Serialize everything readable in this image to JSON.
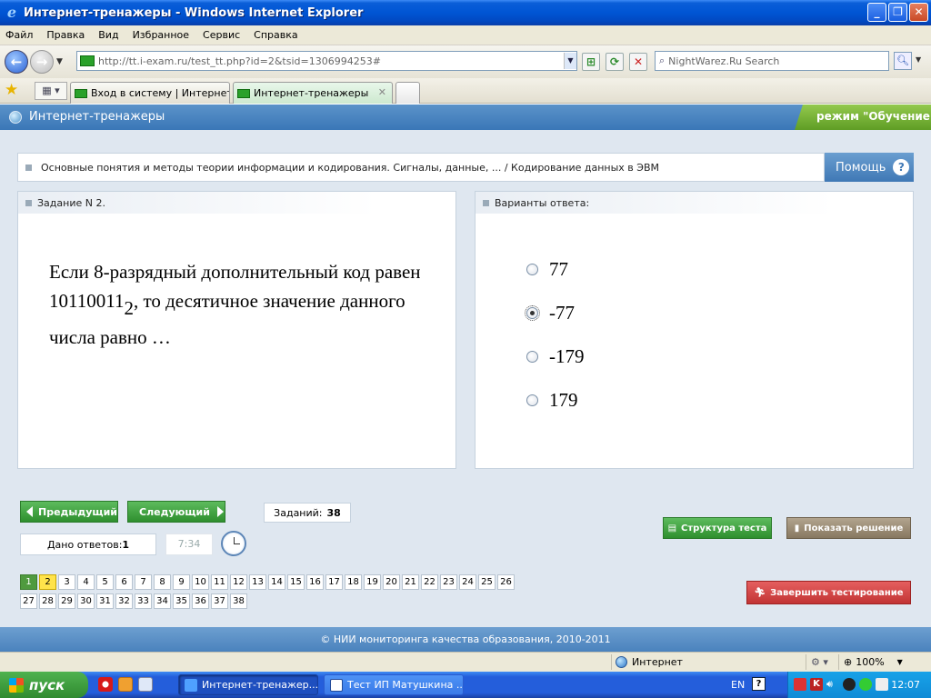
{
  "window": {
    "title": "Интернет-тренажеры - Windows Internet Explorer",
    "min": "_",
    "max": "❐",
    "close": "✕"
  },
  "menu": [
    "Файл",
    "Правка",
    "Вид",
    "Избранное",
    "Сервис",
    "Справка"
  ],
  "address": {
    "url": "http://tt.i-exam.ru/test_tt.php?id=2&tsid=1306994253#",
    "search_placeholder": "NightWarez.Ru Search"
  },
  "tabs": [
    {
      "label": "Вход в систему | Интернет-..."
    },
    {
      "label": "Интернет-тренажеры"
    }
  ],
  "app": {
    "title": "Интернет-тренажеры",
    "mode": "режим \"Обучение\""
  },
  "breadcrumb": "Основные понятия и методы теории информации и кодирования. Сигналы, данные, ... / Кодирование данных в ЭВМ",
  "help_label": "Помощь",
  "help_icon": "?",
  "task": {
    "header": "Задание N 2.",
    "text_before": "Если 8-разрядный дополнительный код равен 10110011",
    "subscript": "2",
    "text_after": ", то десятичное значение данного числа равно …"
  },
  "answers": {
    "header": "Варианты ответа:",
    "options": [
      "77",
      "-77",
      "-179",
      "179"
    ],
    "selected_index": 1
  },
  "nav": {
    "prev": "Предыдущий",
    "next": "Следующий",
    "count_label": "Заданий:",
    "count_value": "38",
    "answered_label": "Дано ответов:",
    "answered_value": "1",
    "time": "7:34"
  },
  "question_numbers": [
    "1",
    "2",
    "3",
    "4",
    "5",
    "6",
    "7",
    "8",
    "9",
    "10",
    "11",
    "12",
    "13",
    "14",
    "15",
    "16",
    "17",
    "18",
    "19",
    "20",
    "21",
    "22",
    "23",
    "24",
    "25",
    "26",
    "27",
    "28",
    "29",
    "30",
    "31",
    "32",
    "33",
    "34",
    "35",
    "36",
    "37",
    "38"
  ],
  "question_done": [
    "1"
  ],
  "question_current": "2",
  "buttons": {
    "structure": "Структура теста",
    "solution": "Показать решение",
    "finish": "Завершить тестирование"
  },
  "footer": "© НИИ мониторинга качества образования, 2010-2011",
  "status": {
    "zone": "Интернет",
    "zoom": "100%"
  },
  "taskbar": {
    "start": "пуск",
    "items": [
      "Интернет-тренажер...",
      "Тест ИП Матушкина ..."
    ],
    "lang": "EN",
    "time": "12:07"
  },
  "colors": {
    "accent_blue": "#3a77b7",
    "green_button": "#2e8f2e",
    "red_button": "#c23434",
    "current_question": "#ffe34a"
  }
}
